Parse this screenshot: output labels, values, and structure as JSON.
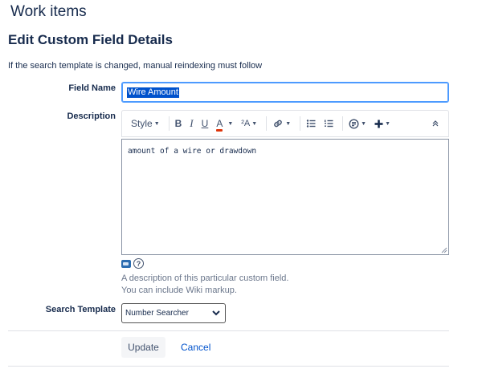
{
  "header": {
    "title": "Work items"
  },
  "section": {
    "title": "Edit Custom Field Details"
  },
  "info": "If the search template is changed, manual reindexing must follow",
  "field_name": {
    "label": "Field Name",
    "value": "Wire Amount"
  },
  "description": {
    "label": "Description",
    "value": "amount of a wire or drawdown",
    "help_line1": "A description of this particular custom field.",
    "help_line2": "You can include Wiki markup."
  },
  "toolbar": {
    "style_label": "Style",
    "bold": "B",
    "italic": "I",
    "underline": "U",
    "text_color": "A",
    "text_effects": "²A"
  },
  "search_template": {
    "label": "Search Template",
    "selected": "Number Searcher"
  },
  "actions": {
    "update": "Update",
    "cancel": "Cancel"
  },
  "colors": {
    "accent": "#0052cc",
    "focus": "#4c9aff",
    "text_color_bar": "#de350b"
  }
}
